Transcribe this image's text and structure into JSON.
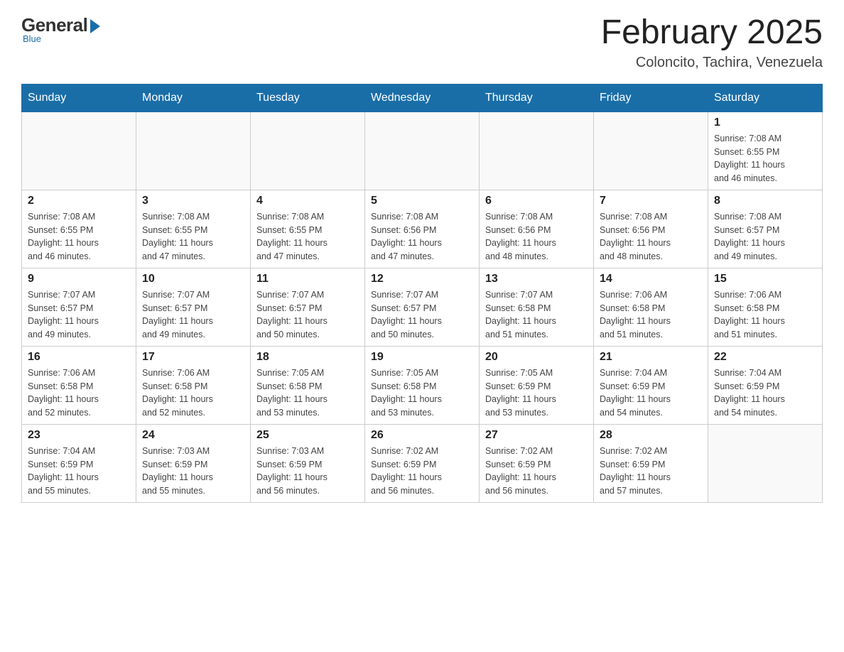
{
  "header": {
    "logo": {
      "general": "General",
      "blue": "Blue",
      "subtitle": "Blue"
    },
    "title": "February 2025",
    "location": "Coloncito, Tachira, Venezuela"
  },
  "days_of_week": [
    "Sunday",
    "Monday",
    "Tuesday",
    "Wednesday",
    "Thursday",
    "Friday",
    "Saturday"
  ],
  "weeks": [
    [
      {
        "day": "",
        "info": ""
      },
      {
        "day": "",
        "info": ""
      },
      {
        "day": "",
        "info": ""
      },
      {
        "day": "",
        "info": ""
      },
      {
        "day": "",
        "info": ""
      },
      {
        "day": "",
        "info": ""
      },
      {
        "day": "1",
        "info": "Sunrise: 7:08 AM\nSunset: 6:55 PM\nDaylight: 11 hours\nand 46 minutes."
      }
    ],
    [
      {
        "day": "2",
        "info": "Sunrise: 7:08 AM\nSunset: 6:55 PM\nDaylight: 11 hours\nand 46 minutes."
      },
      {
        "day": "3",
        "info": "Sunrise: 7:08 AM\nSunset: 6:55 PM\nDaylight: 11 hours\nand 47 minutes."
      },
      {
        "day": "4",
        "info": "Sunrise: 7:08 AM\nSunset: 6:55 PM\nDaylight: 11 hours\nand 47 minutes."
      },
      {
        "day": "5",
        "info": "Sunrise: 7:08 AM\nSunset: 6:56 PM\nDaylight: 11 hours\nand 47 minutes."
      },
      {
        "day": "6",
        "info": "Sunrise: 7:08 AM\nSunset: 6:56 PM\nDaylight: 11 hours\nand 48 minutes."
      },
      {
        "day": "7",
        "info": "Sunrise: 7:08 AM\nSunset: 6:56 PM\nDaylight: 11 hours\nand 48 minutes."
      },
      {
        "day": "8",
        "info": "Sunrise: 7:08 AM\nSunset: 6:57 PM\nDaylight: 11 hours\nand 49 minutes."
      }
    ],
    [
      {
        "day": "9",
        "info": "Sunrise: 7:07 AM\nSunset: 6:57 PM\nDaylight: 11 hours\nand 49 minutes."
      },
      {
        "day": "10",
        "info": "Sunrise: 7:07 AM\nSunset: 6:57 PM\nDaylight: 11 hours\nand 49 minutes."
      },
      {
        "day": "11",
        "info": "Sunrise: 7:07 AM\nSunset: 6:57 PM\nDaylight: 11 hours\nand 50 minutes."
      },
      {
        "day": "12",
        "info": "Sunrise: 7:07 AM\nSunset: 6:57 PM\nDaylight: 11 hours\nand 50 minutes."
      },
      {
        "day": "13",
        "info": "Sunrise: 7:07 AM\nSunset: 6:58 PM\nDaylight: 11 hours\nand 51 minutes."
      },
      {
        "day": "14",
        "info": "Sunrise: 7:06 AM\nSunset: 6:58 PM\nDaylight: 11 hours\nand 51 minutes."
      },
      {
        "day": "15",
        "info": "Sunrise: 7:06 AM\nSunset: 6:58 PM\nDaylight: 11 hours\nand 51 minutes."
      }
    ],
    [
      {
        "day": "16",
        "info": "Sunrise: 7:06 AM\nSunset: 6:58 PM\nDaylight: 11 hours\nand 52 minutes."
      },
      {
        "day": "17",
        "info": "Sunrise: 7:06 AM\nSunset: 6:58 PM\nDaylight: 11 hours\nand 52 minutes."
      },
      {
        "day": "18",
        "info": "Sunrise: 7:05 AM\nSunset: 6:58 PM\nDaylight: 11 hours\nand 53 minutes."
      },
      {
        "day": "19",
        "info": "Sunrise: 7:05 AM\nSunset: 6:58 PM\nDaylight: 11 hours\nand 53 minutes."
      },
      {
        "day": "20",
        "info": "Sunrise: 7:05 AM\nSunset: 6:59 PM\nDaylight: 11 hours\nand 53 minutes."
      },
      {
        "day": "21",
        "info": "Sunrise: 7:04 AM\nSunset: 6:59 PM\nDaylight: 11 hours\nand 54 minutes."
      },
      {
        "day": "22",
        "info": "Sunrise: 7:04 AM\nSunset: 6:59 PM\nDaylight: 11 hours\nand 54 minutes."
      }
    ],
    [
      {
        "day": "23",
        "info": "Sunrise: 7:04 AM\nSunset: 6:59 PM\nDaylight: 11 hours\nand 55 minutes."
      },
      {
        "day": "24",
        "info": "Sunrise: 7:03 AM\nSunset: 6:59 PM\nDaylight: 11 hours\nand 55 minutes."
      },
      {
        "day": "25",
        "info": "Sunrise: 7:03 AM\nSunset: 6:59 PM\nDaylight: 11 hours\nand 56 minutes."
      },
      {
        "day": "26",
        "info": "Sunrise: 7:02 AM\nSunset: 6:59 PM\nDaylight: 11 hours\nand 56 minutes."
      },
      {
        "day": "27",
        "info": "Sunrise: 7:02 AM\nSunset: 6:59 PM\nDaylight: 11 hours\nand 56 minutes."
      },
      {
        "day": "28",
        "info": "Sunrise: 7:02 AM\nSunset: 6:59 PM\nDaylight: 11 hours\nand 57 minutes."
      },
      {
        "day": "",
        "info": ""
      }
    ]
  ]
}
